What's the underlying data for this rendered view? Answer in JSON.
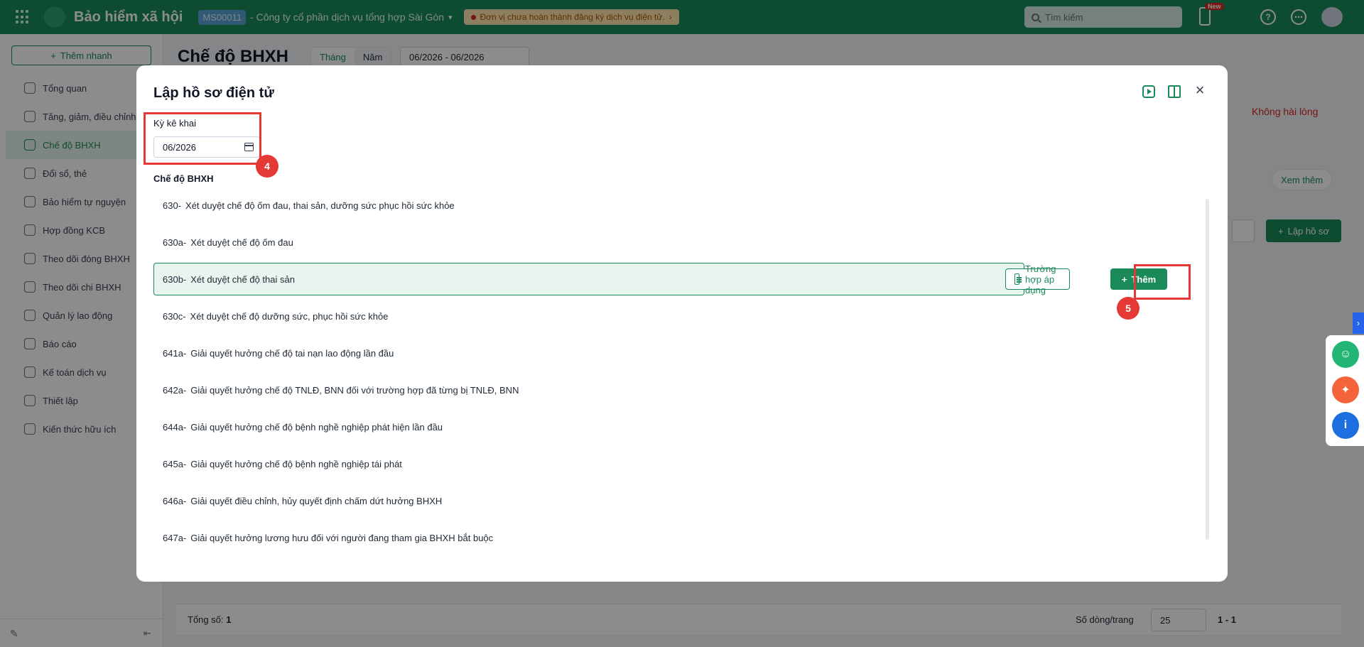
{
  "topbar": {
    "app_title": "Bảo hiểm xã hội",
    "company_code": "MS00011",
    "company_name": "- Công ty cổ phần dịch vụ tổng hợp Sài Gòn",
    "warning": "Đơn vị chưa hoàn thành đăng ký dịch vụ điện tử.",
    "search_placeholder": "Tìm kiếm",
    "new_badge": "New"
  },
  "sidebar": {
    "quick_add": "Thêm nhanh",
    "items": [
      {
        "label": "Tổng quan"
      },
      {
        "label": "Tăng, giảm, điều chỉnh"
      },
      {
        "label": "Chế độ BHXH"
      },
      {
        "label": "Đổi sổ, thẻ"
      },
      {
        "label": "Bảo hiểm tự nguyện"
      },
      {
        "label": "Hợp đồng KCB"
      },
      {
        "label": "Theo dõi đóng BHXH"
      },
      {
        "label": "Theo dõi chi BHXH"
      },
      {
        "label": "Quản lý lao động"
      },
      {
        "label": "Báo cáo"
      },
      {
        "label": "Kế toán dịch vụ"
      },
      {
        "label": "Thiết lập"
      },
      {
        "label": "Kiến thức hữu ích"
      }
    ]
  },
  "page": {
    "title": "Chế độ BHXH",
    "seg_month": "Tháng",
    "seg_year": "Năm",
    "range": "06/2026 - 06/2026",
    "dislike": "Không hài lòng",
    "see_more": "Xem thêm",
    "create": "Lập hồ sơ",
    "total_label": "Tổng số:",
    "total_value": "1",
    "rows_label": "Số dòng/trang",
    "rows_value": "25",
    "pager_range": "1 - 1"
  },
  "modal": {
    "title": "Lập hồ sơ điện tử",
    "period_label": "Kỳ kê khai",
    "period_value": "06/2026",
    "section_label": "Chế độ BHXH",
    "step4": "4",
    "step5": "5",
    "case_button": "Trường hợp áp dụng",
    "add_button": "Thêm",
    "items": [
      {
        "code": "630-",
        "label": "Xét duyệt chế độ ốm đau, thai sản, dưỡng sức phục hồi sức khỏe"
      },
      {
        "code": "630a-",
        "label": "Xét duyệt chế độ ốm đau"
      },
      {
        "code": "630b-",
        "label": "Xét duyệt chế độ thai sản"
      },
      {
        "code": "630c-",
        "label": "Xét duyệt chế độ dưỡng sức, phục hồi sức khỏe"
      },
      {
        "code": "641a-",
        "label": "Giải quyết hưởng chế độ tai nạn lao động lần đầu"
      },
      {
        "code": "642a-",
        "label": "Giải quyết hưởng chế độ TNLĐ, BNN đối với trường hợp đã từng bị TNLĐ, BNN"
      },
      {
        "code": "644a-",
        "label": "Giải quyết hưởng chế độ bệnh nghề nghiệp phát hiện lần đầu"
      },
      {
        "code": "645a-",
        "label": "Giải quyết hưởng chế độ bệnh nghề nghiệp tái phát"
      },
      {
        "code": "646a-",
        "label": "Giải quyết điều chỉnh, hủy quyết định chấm dứt hưởng BHXH"
      },
      {
        "code": "647a-",
        "label": "Giải quyết hưởng lương hưu đối với người đang tham gia BHXH bắt buộc"
      }
    ]
  },
  "colors": {
    "brand": "#1a8a5a",
    "highlight": "#e53935"
  }
}
